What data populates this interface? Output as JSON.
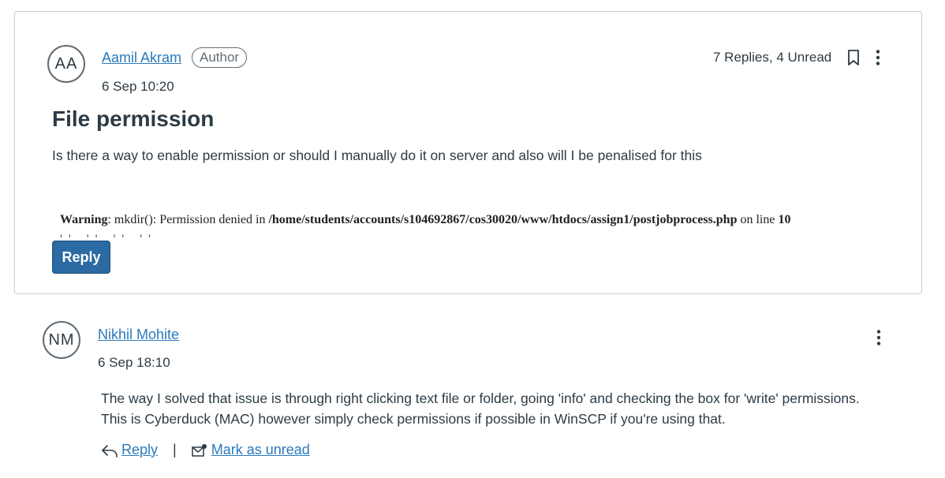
{
  "topic": {
    "avatar_initials": "AA",
    "author_name": "Aamil Akram",
    "role_badge": "Author",
    "timestamp": "6 Sep 10:20",
    "reply_status": "7 Replies, 4 Unread",
    "title": "File permission",
    "body": "Is there a way to enable permission or should I manually do it on server and also will I be penalised for this",
    "warning_image": {
      "label": "Warning",
      "message": ": mkdir(): Permission denied in ",
      "path": "/home/students/accounts/s104692867/cos30020/www/htdocs/assign1/postjobprocess.php",
      "on_line_text": " on line ",
      "line_number": "10"
    },
    "reply_button": "Reply",
    "icons": [
      "bookmark-icon",
      "more-options-icon"
    ]
  },
  "reply": {
    "avatar_initials": "NM",
    "author_name": "Nikhil Mohite",
    "timestamp": "6 Sep 18:10",
    "body_line1": "The way I solved that issue is through right clicking text file or folder, going 'info' and checking the box for 'write' permissions.",
    "body_line2": "This is Cyberduck (MAC) however simply check permissions if possible in WinSCP if you're using that.",
    "reply_link": "Reply",
    "separator": "|",
    "mark_unread_link": "Mark as unread",
    "icons": [
      "more-options-icon",
      "reply-arrow-icon",
      "mark-unread-icon"
    ]
  },
  "colors": {
    "link": "#2b7abc",
    "button": "#2b6aa3",
    "text": "#2d3b45",
    "border": "#c7cdd1"
  }
}
